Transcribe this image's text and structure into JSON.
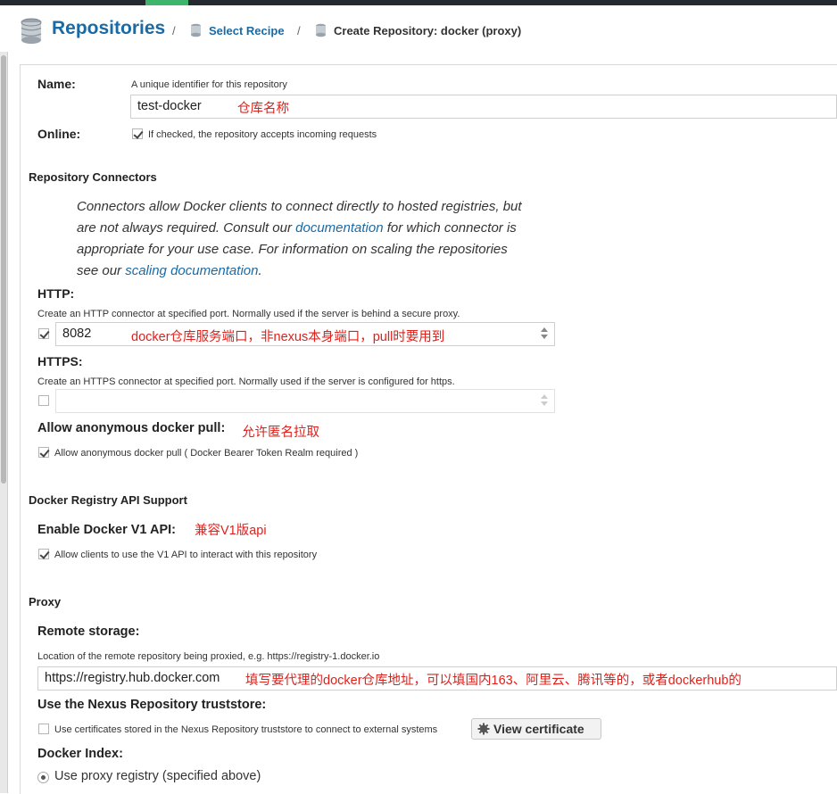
{
  "header": {
    "title": "Repositories",
    "separator": "/",
    "crumbs": [
      "Select Recipe",
      "Create Repository: docker (proxy)"
    ]
  },
  "form": {
    "name": {
      "label": "Name:",
      "help": "A unique identifier for this repository",
      "value": "test-docker",
      "annotation": "仓库名称"
    },
    "online": {
      "label": "Online:",
      "checked": true,
      "help": "If checked, the repository accepts incoming requests"
    },
    "connectors": {
      "section": "Repository Connectors",
      "desc_1": "Connectors allow Docker clients to connect directly to hosted registries, but are not always required. Consult our ",
      "desc_link_1": "documentation",
      "desc_2": " for which connector is appropriate for your use case. For information on scaling the repositories see our ",
      "desc_link_2": "scaling documentation",
      "desc_3": "."
    },
    "http": {
      "label": "HTTP:",
      "help": "Create an HTTP connector at specified port. Normally used if the server is behind a secure proxy.",
      "checked": true,
      "value": "8082",
      "annotation": "docker仓库服务端口，非nexus本身端口，pull时要用到"
    },
    "https": {
      "label": "HTTPS:",
      "help": "Create an HTTPS connector at specified port. Normally used if the server is configured for https.",
      "checked": false,
      "value": ""
    },
    "anonymous": {
      "label": "Allow anonymous docker pull:",
      "annotation": "允许匿名拉取",
      "checked": true,
      "help": "Allow anonymous docker pull ( Docker Bearer Token Realm required )"
    },
    "api": {
      "section": "Docker Registry API Support",
      "label": "Enable Docker V1 API:",
      "annotation": "兼容V1版api",
      "checked": true,
      "help": "Allow clients to use the V1 API to interact with this repository"
    },
    "proxy": {
      "section": "Proxy",
      "remote_label": "Remote storage:",
      "remote_help": "Location of the remote repository being proxied, e.g. https://registry-1.docker.io",
      "remote_value": "https://registry.hub.docker.com",
      "remote_annotation": "填写要代理的docker仓库地址，可以填国内163、阿里云、腾讯等的，或者dockerhub的",
      "truststore_label": "Use the Nexus Repository truststore:",
      "truststore_checked": false,
      "truststore_help": "Use certificates stored in the Nexus Repository truststore to connect to external systems",
      "view_cert_button": "View certificate",
      "index_label": "Docker Index:",
      "index_option": "Use proxy registry (specified above)"
    }
  },
  "colors": {
    "link": "#1a6aa5",
    "annotation": "#e0201b",
    "topbar": "#252a30",
    "tab_accent": "#3fb56c"
  }
}
